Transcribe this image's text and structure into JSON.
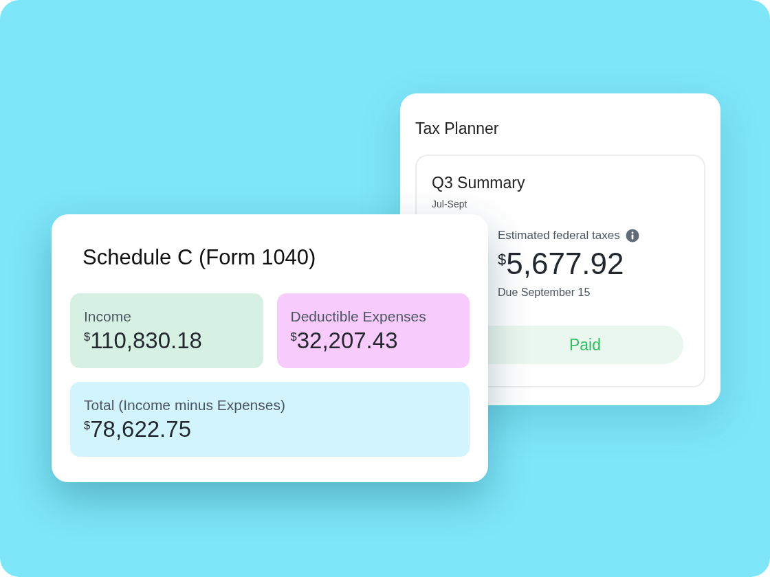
{
  "planner": {
    "title": "Tax Planner",
    "summary": {
      "title": "Q3 Summary",
      "period": "Jul-Sept",
      "estimate_label": "Estimated federal taxes",
      "currency": "$",
      "amount": "5,677.92",
      "due": "Due September 15",
      "status": "Paid"
    }
  },
  "schedule": {
    "title": "Schedule C (Form 1040)",
    "tiles": [
      {
        "label": "Income",
        "currency": "$",
        "amount": "110,830.18",
        "color": "#d6f1e3"
      },
      {
        "label": "Deductible Expenses",
        "currency": "$",
        "amount": "32,207.43",
        "color": "#f7cbfc"
      },
      {
        "label": "Total (Income minus Expenses)",
        "currency": "$",
        "amount": "78,622.75",
        "color": "#d1f4fd"
      }
    ]
  }
}
